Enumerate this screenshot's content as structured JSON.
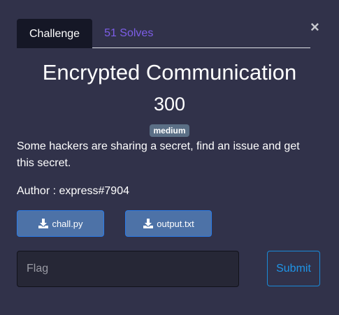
{
  "modal": {
    "close_glyph": "×"
  },
  "tabs": [
    {
      "label": "Challenge",
      "active": true
    },
    {
      "label": "51 Solves",
      "active": false
    }
  ],
  "challenge": {
    "title": "Encrypted Communication",
    "points": "300",
    "difficulty": "medium",
    "description": "Some hackers are sharing a secret, find an issue and get this secret.",
    "author": "Author : express#7904"
  },
  "files": [
    {
      "name": "chall.py",
      "icon": "download-icon"
    },
    {
      "name": "output.txt",
      "icon": "download-icon"
    }
  ],
  "form": {
    "flag_placeholder": "Flag",
    "submit_label": "Submit"
  },
  "colors": {
    "background": "#31324a",
    "active_tab": "#151726",
    "inactive_tab_text": "#7d5ee8",
    "badge": "#5b6f86",
    "file_button": "#4d72a7",
    "submit_border": "#1a8ad8"
  }
}
